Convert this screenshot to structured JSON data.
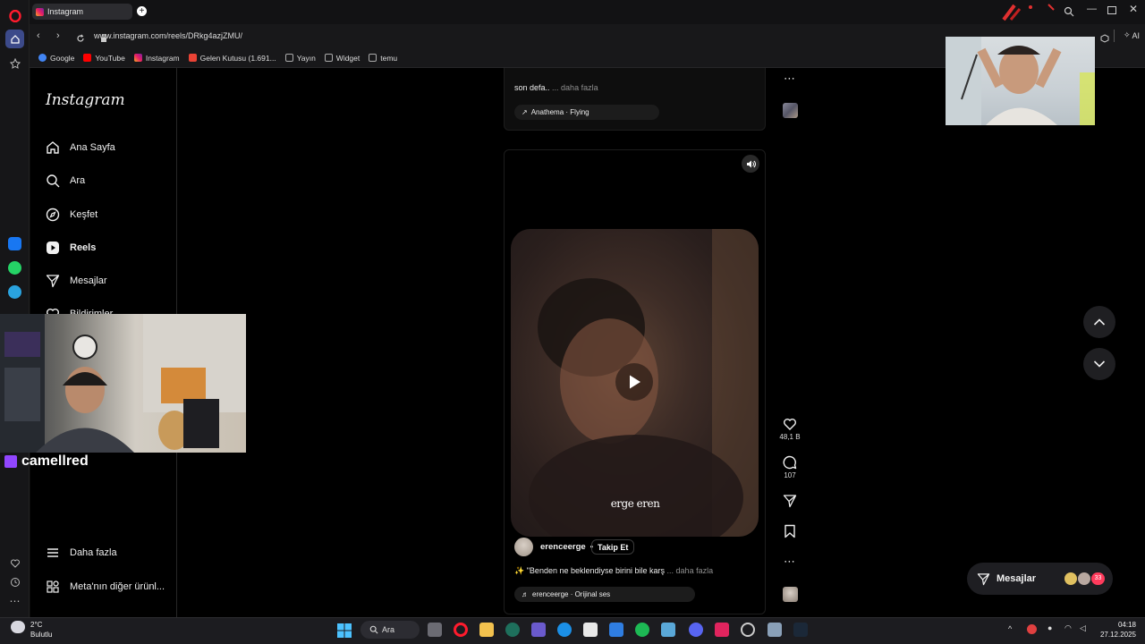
{
  "browser": {
    "tab_title": "Instagram",
    "url": "www.instagram.com/reels/DRkg4azjZMU/",
    "ai_label": "AI",
    "bookmarks": [
      {
        "label": "Google",
        "icon": "google-icon",
        "color": "#4285F4"
      },
      {
        "label": "YouTube",
        "icon": "youtube-icon",
        "color": "#FF0000"
      },
      {
        "label": "Instagram",
        "icon": "instagram-icon",
        "color": "#E1306C"
      },
      {
        "label": "Gelen Kutusu (1.691...",
        "icon": "gmail-icon",
        "color": "#EA4335"
      },
      {
        "label": "Yayın",
        "icon": "folder-icon",
        "color": "#aaaaaa"
      },
      {
        "label": "Widget",
        "icon": "folder-icon",
        "color": "#aaaaaa"
      },
      {
        "label": "temu",
        "icon": "folder-icon",
        "color": "#aaaaaa"
      }
    ]
  },
  "sidebar": {
    "logo": "Instagram",
    "items": [
      {
        "label": "Ana Sayfa",
        "icon": "home-icon"
      },
      {
        "label": "Ara",
        "icon": "search-icon"
      },
      {
        "label": "Keşfet",
        "icon": "compass-icon"
      },
      {
        "label": "Reels",
        "icon": "reels-icon"
      },
      {
        "label": "Mesajlar",
        "icon": "send-icon"
      },
      {
        "label": "Bildirimler",
        "icon": "heart-icon"
      }
    ],
    "more_label": "Daha fazla",
    "meta_label": "Meta'nın diğer ürünl..."
  },
  "previous_post": {
    "caption": "son defa..",
    "more": "... daha fazla",
    "music": "Anathema · Flying"
  },
  "reel": {
    "username": "erenceerge",
    "follow_label": "Takip Et",
    "dot": "•",
    "caption_emoji": "✨",
    "caption": "\"Benden ne beklendiyse birini bile karş",
    "more": "... daha fazla",
    "audio": "erenceerge · Orijinal ses",
    "watermark": "erge eren",
    "likes": "48,1 B",
    "comments": "107"
  },
  "stream": {
    "channel": "camellred"
  },
  "messages_button": {
    "label": "Mesajlar",
    "badge": "33"
  },
  "taskbar": {
    "weather_temp": "2°C",
    "weather_desc": "Bulutlu",
    "search_label": "Ara",
    "time": "04:18",
    "date": "27.12.2025"
  },
  "colors": {
    "accent_blue": "#0095f6",
    "ig_bg": "#000000",
    "twitch_purple": "#9146FF",
    "opera_red": "#FF1B2D"
  }
}
